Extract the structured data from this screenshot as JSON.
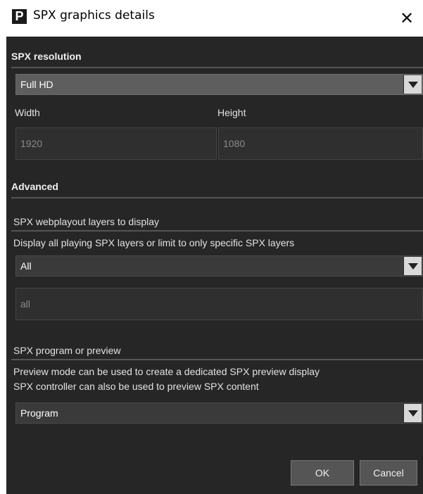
{
  "window": {
    "title": "SPX graphics details",
    "app_icon_letter": "P",
    "close_glyph": "✕",
    "icons": [
      "app-logo-icon",
      "close-icon"
    ]
  },
  "resolution": {
    "heading": "SPX resolution",
    "preset_value": "Full HD",
    "width_label": "Width",
    "height_label": "Height",
    "width_value": "1920",
    "height_value": "1080"
  },
  "advanced": {
    "heading": "Advanced"
  },
  "layers": {
    "heading": "SPX webplayout layers to display",
    "description": "Display all playing SPX layers or limit to only specific SPX layers",
    "select_value": "All",
    "input_value": "all"
  },
  "program": {
    "heading": "SPX program or preview",
    "description_line1": "Preview mode can be used to create a dedicated SPX preview display",
    "description_line2": "SPX controller can also be used to preview SPX content",
    "select_value": "Program"
  },
  "footer": {
    "ok_label": "OK",
    "cancel_label": "Cancel"
  },
  "colors": {
    "panel_bg": "#262626",
    "select_active_bg": "#5e5e5e",
    "button_bg": "#555555"
  }
}
